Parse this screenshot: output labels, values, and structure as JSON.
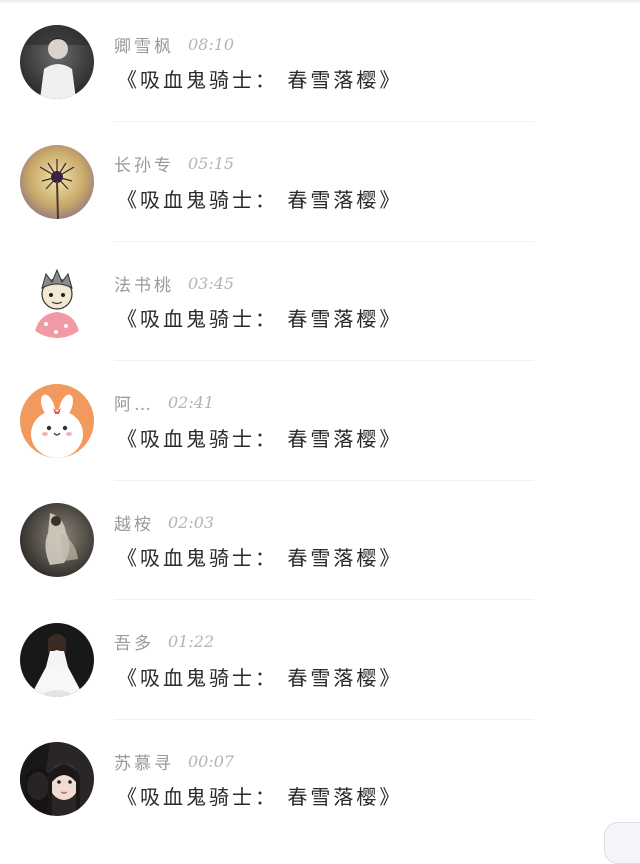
{
  "comments": [
    {
      "name": "卿雪枫",
      "time": "08:10",
      "text": "《吸血鬼骑士： 春雪落樱》",
      "avatar": "man-in-white-shirt-photo"
    },
    {
      "name": "长孙专",
      "time": "05:15",
      "text": "《吸血鬼骑士： 春雪落樱》",
      "avatar": "dandelion-flower-photo"
    },
    {
      "name": "法书桃",
      "time": "03:45",
      "text": "《吸血鬼骑士： 春雪落樱》",
      "avatar": "cartoon-boy-in-pink-robe"
    },
    {
      "name": "阿…",
      "time": "02:41",
      "text": "《吸血鬼骑士： 春雪落樱》",
      "avatar": "cute-bunny-cartoon"
    },
    {
      "name": "越桉",
      "time": "02:03",
      "text": "《吸血鬼骑士： 春雪落樱》",
      "avatar": "dark-dancer-photo"
    },
    {
      "name": "吾多",
      "time": "01:22",
      "text": "《吸血鬼骑士： 春雪落樱》",
      "avatar": "girl-in-white-dress-photo"
    },
    {
      "name": "苏慕寻",
      "time": "00:07",
      "text": "《吸血鬼骑士： 春雪落樱》",
      "avatar": "two-girls-selfie-photo"
    }
  ],
  "colors": {
    "name": "#9a9a9a",
    "time": "#b4b4b4",
    "message": "#2a2a2a",
    "divider": "#f1f1f1"
  }
}
